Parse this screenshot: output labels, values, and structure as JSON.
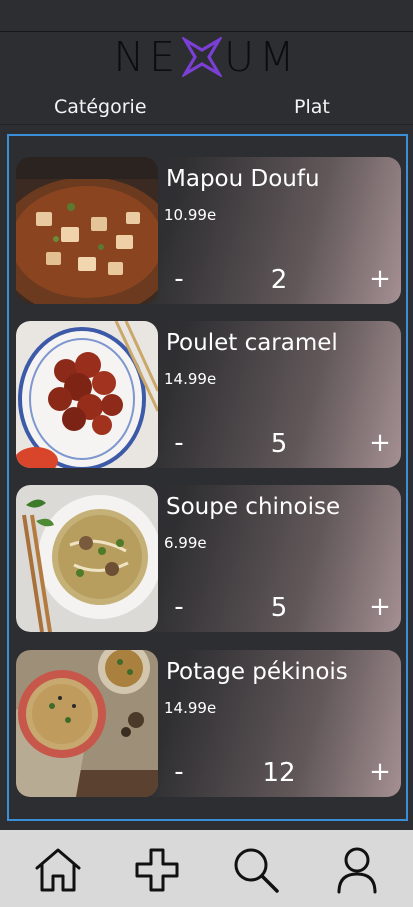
{
  "header": {
    "logo": "NEXUM",
    "tabs": [
      {
        "label": "Catégorie"
      },
      {
        "label": "Plat"
      }
    ]
  },
  "colors": {
    "accent_border": "#3b8fd9",
    "logo_x": "#7b3fd6",
    "background": "#2c2e31",
    "navbar": "#d9d9d9"
  },
  "items": [
    {
      "name": "Mapou Doufu",
      "price": "10.99e",
      "quantity": "2",
      "minus": "-",
      "plus": "+"
    },
    {
      "name": "Poulet caramel",
      "price": "14.99e",
      "quantity": "5",
      "minus": "-",
      "plus": "+"
    },
    {
      "name": "Soupe chinoise",
      "price": "6.99e",
      "quantity": "5",
      "minus": "-",
      "plus": "+"
    },
    {
      "name": "Potage pékinois",
      "price": "14.99e",
      "quantity": "12",
      "minus": "-",
      "plus": "+"
    }
  ],
  "navbar": {
    "icons": [
      "home-icon",
      "add-icon",
      "search-icon",
      "profile-icon"
    ]
  }
}
